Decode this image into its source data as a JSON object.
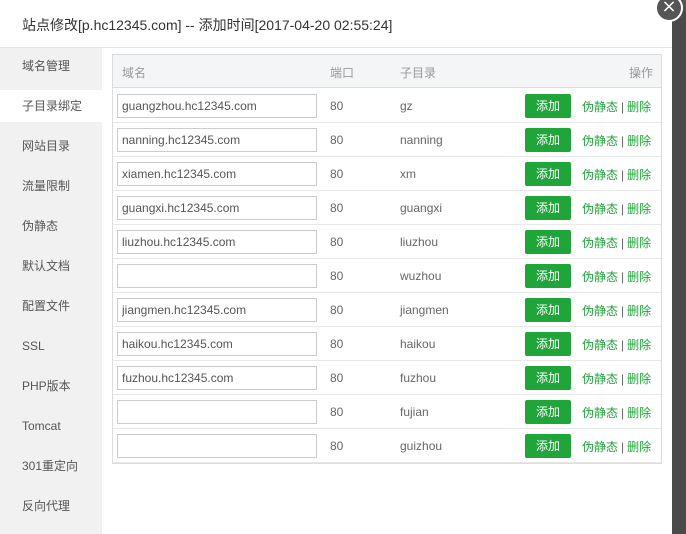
{
  "dialog": {
    "title": "站点修改[p.hc12345.com] -- 添加时间[2017-04-20 02:55:24]",
    "close_glyph": "×"
  },
  "sidebar": {
    "items": [
      {
        "label": "域名管理",
        "active": false
      },
      {
        "label": "子目录绑定",
        "active": true
      },
      {
        "label": "网站目录",
        "active": false
      },
      {
        "label": "流量限制",
        "active": false
      },
      {
        "label": "伪静态",
        "active": false
      },
      {
        "label": "默认文档",
        "active": false
      },
      {
        "label": "配置文件",
        "active": false
      },
      {
        "label": "SSL",
        "active": false
      },
      {
        "label": "PHP版本",
        "active": false
      },
      {
        "label": "Tomcat",
        "active": false
      },
      {
        "label": "301重定向",
        "active": false
      },
      {
        "label": "反向代理",
        "active": false
      }
    ]
  },
  "table": {
    "headers": {
      "domain": "域名",
      "port": "端口",
      "subdir": "子目录",
      "action": "操作"
    },
    "add_label": "添加",
    "rewrite_label": "伪静态",
    "separator": "|",
    "delete_label": "删除",
    "rows": [
      {
        "domain": "guangzhou.hc12345.com",
        "port": "80",
        "subdir": "gz"
      },
      {
        "domain": "nanning.hc12345.com",
        "port": "80",
        "subdir": "nanning"
      },
      {
        "domain": "xiamen.hc12345.com",
        "port": "80",
        "subdir": "xm"
      },
      {
        "domain": "guangxi.hc12345.com",
        "port": "80",
        "subdir": "guangxi"
      },
      {
        "domain": "liuzhou.hc12345.com",
        "port": "80",
        "subdir": "liuzhou"
      },
      {
        "domain": "",
        "port": "80",
        "subdir": "wuzhou"
      },
      {
        "domain": "jiangmen.hc12345.com",
        "port": "80",
        "subdir": "jiangmen"
      },
      {
        "domain": "haikou.hc12345.com",
        "port": "80",
        "subdir": "haikou"
      },
      {
        "domain": "fuzhou.hc12345.com",
        "port": "80",
        "subdir": "fuzhou"
      },
      {
        "domain": "",
        "port": "80",
        "subdir": "fujian"
      },
      {
        "domain": "",
        "port": "80",
        "subdir": "guizhou"
      }
    ]
  }
}
